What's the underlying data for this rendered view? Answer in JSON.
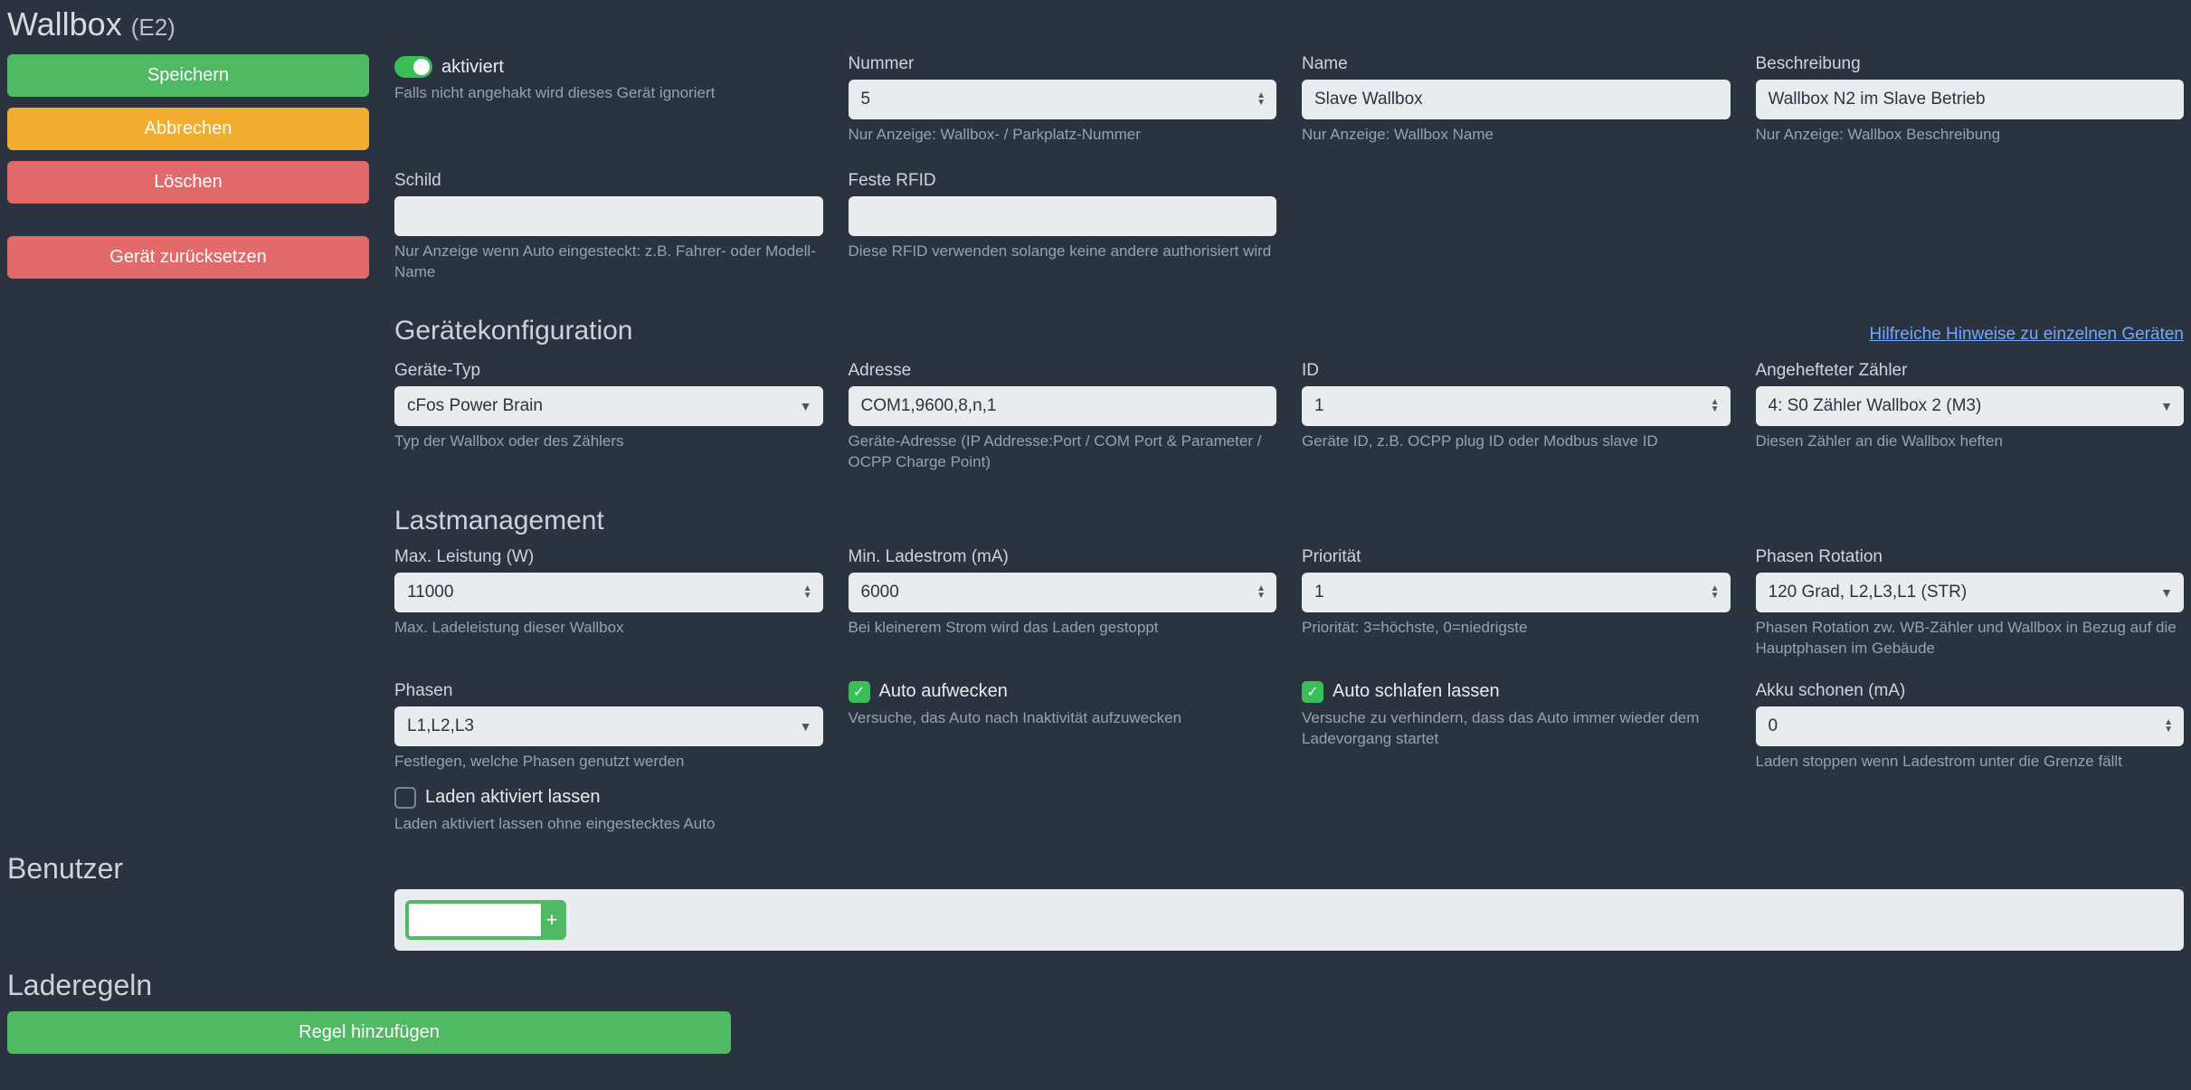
{
  "title": {
    "main": "Wallbox",
    "suffix": "(E2)"
  },
  "sidebar": {
    "save": "Speichern",
    "cancel": "Abbrechen",
    "delete": "Löschen",
    "reset": "Gerät zurücksetzen"
  },
  "row1": {
    "activated": {
      "label": "aktiviert",
      "help": "Falls nicht angehakt wird dieses Gerät ignoriert",
      "checked": true
    },
    "number": {
      "label": "Nummer",
      "value": "5",
      "help": "Nur Anzeige: Wallbox- / Parkplatz-Nummer"
    },
    "name": {
      "label": "Name",
      "value": "Slave Wallbox",
      "help": "Nur Anzeige: Wallbox Name"
    },
    "desc": {
      "label": "Beschreibung",
      "value": "Wallbox N2 im Slave Betrieb",
      "help": "Nur Anzeige: Wallbox Beschreibung"
    }
  },
  "row2": {
    "schild": {
      "label": "Schild",
      "value": "",
      "help": "Nur Anzeige wenn Auto eingesteckt: z.B. Fahrer- oder Modell-Name"
    },
    "rfid": {
      "label": "Feste RFID",
      "value": "",
      "help": "Diese RFID verwenden solange keine andere authorisiert wird"
    }
  },
  "config": {
    "heading": "Gerätekonfiguration",
    "link": "Hilfreiche Hinweise zu einzelnen Geräten",
    "type": {
      "label": "Geräte-Typ",
      "value": "cFos Power Brain",
      "help": "Typ der Wallbox oder des Zählers"
    },
    "address": {
      "label": "Adresse",
      "value": "COM1,9600,8,n,1",
      "help": "Geräte-Adresse (IP Addresse:Port / COM Port & Parameter / OCPP Charge Point)"
    },
    "id": {
      "label": "ID",
      "value": "1",
      "help": "Geräte ID, z.B. OCPP plug ID oder Modbus slave ID"
    },
    "meter": {
      "label": "Angehefteter Zähler",
      "value": "4: S0 Zähler Wallbox 2 (M3)",
      "help": "Diesen Zähler an die Wallbox heften"
    }
  },
  "load": {
    "heading": "Lastmanagement",
    "maxpower": {
      "label": "Max. Leistung (W)",
      "value": "11000",
      "help": "Max. Ladeleistung dieser Wallbox"
    },
    "mincur": {
      "label": "Min. Ladestrom (mA)",
      "value": "6000",
      "help": "Bei kleinerem Strom wird das Laden gestoppt"
    },
    "prio": {
      "label": "Priorität",
      "value": "1",
      "help": "Priorität: 3=höchste, 0=niedrigste"
    },
    "phrot": {
      "label": "Phasen Rotation",
      "value": "120 Grad, L2,L3,L1 (STR)",
      "help": "Phasen Rotation zw. WB-Zähler und Wallbox in Bezug auf die Hauptphasen im Gebäude"
    },
    "phases": {
      "label": "Phasen",
      "value": "L1,L2,L3",
      "help": "Festlegen, welche Phasen genutzt werden"
    },
    "wake": {
      "label": "Auto aufwecken",
      "checked": true,
      "help": "Versuche, das Auto nach Inaktivität aufzuwecken"
    },
    "sleep": {
      "label": "Auto schlafen lassen",
      "checked": true,
      "help": "Versuche zu verhindern, dass das Auto immer wieder dem Ladevorgang startet"
    },
    "akku": {
      "label": "Akku schonen (mA)",
      "value": "0",
      "help": "Laden stoppen wenn Ladestrom unter die Grenze fällt"
    },
    "keep": {
      "label": "Laden aktiviert lassen",
      "checked": false,
      "help": "Laden aktiviert lassen ohne eingestecktes Auto"
    }
  },
  "users": {
    "heading": "Benutzer",
    "add_placeholder": "",
    "add_button": "+"
  },
  "rules": {
    "heading": "Laderegeln",
    "add": "Regel hinzufügen"
  }
}
